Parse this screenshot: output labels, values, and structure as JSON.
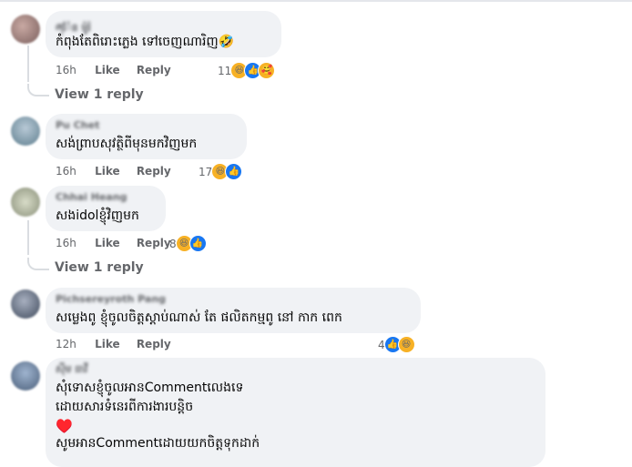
{
  "comments": [
    {
      "name": "ཞ៉ែន​ ម៉ូរ៉",
      "lines": [
        "កំពុងតែពិរោះភ្លេង ទៅចេញណារិញ🤣"
      ],
      "time": "16h",
      "like": "Like",
      "reply": "Reply",
      "reactions": "11",
      "view_replies": "View 1 reply"
    },
    {
      "name": "Pu Chet",
      "lines": [
        "សង់ព្រាបសុវត្ថិពីមុនមកវិញមក"
      ],
      "time": "16h",
      "like": "Like",
      "reply": "Reply",
      "reactions": "17"
    },
    {
      "name": "Chhai Heang",
      "lines": [
        "សងidolខ្ញុំវិញមក"
      ],
      "time": "16h",
      "like": "Like",
      "reply": "Reply",
      "reactions": "8",
      "view_replies": "View 1 reply"
    },
    {
      "name": "Pichsereyroth Pang",
      "lines": [
        "សម្លេងពូ ខ្ញុំចូលចិត្តស្ដាប់ណាស់ តែ ផលិតកម្មពូ នៅ កាក ពេក"
      ],
      "time": "12h",
      "like": "Like",
      "reply": "Reply",
      "reactions": "4"
    },
    {
      "name": "ស៊ីម ធាវី",
      "lines": [
        "សុំទោសខ្ញុំចូលអានCommentលេងទេ",
        "ដោយសារទំនេរពីការងារបន្តិច",
        "♥️",
        "សូមអានCommentដោយយកចិត្តទុកដាក់"
      ]
    }
  ],
  "colors": {
    "bubble": "#f0f2f5",
    "meta_text": "#65676b",
    "like_blue": "#1877f2",
    "haha_yellow": "#f7b125",
    "heart_red": "#e41e3f"
  },
  "icons": [
    "haha-reaction-icon",
    "like-reaction-icon",
    "care-reaction-icon",
    "heart-emoji"
  ]
}
